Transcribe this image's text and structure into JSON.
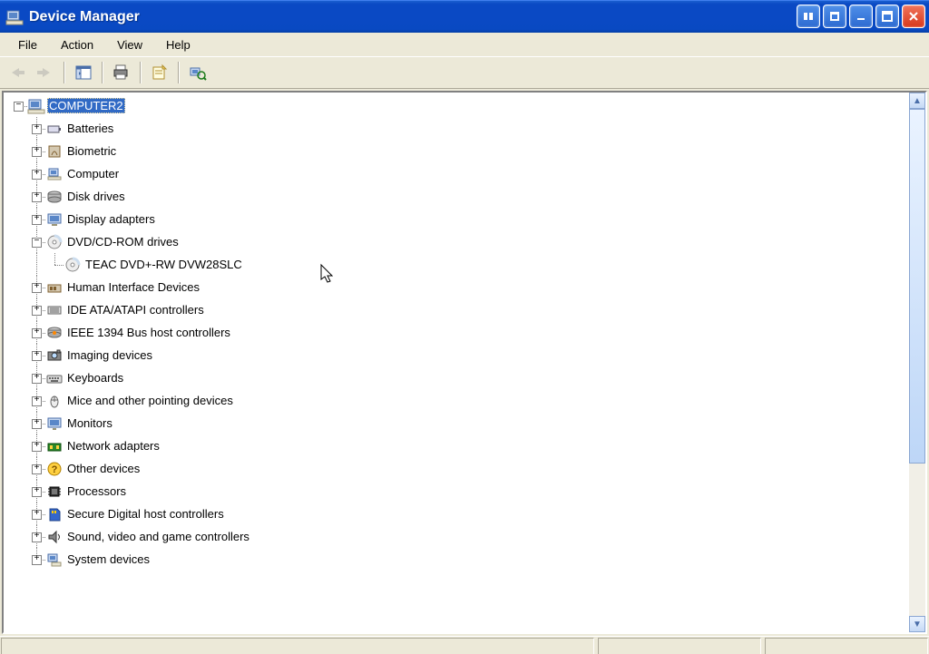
{
  "window": {
    "title": "Device Manager"
  },
  "menu": {
    "items": [
      "File",
      "Action",
      "View",
      "Help"
    ]
  },
  "toolbar": {
    "back": "back-arrow",
    "forward": "forward-arrow",
    "show_hide": "show-hide-console-tree",
    "print": "print",
    "properties": "properties",
    "scan": "scan-hardware"
  },
  "tree": {
    "root": {
      "label": "COMPUTER2",
      "icon": "computer",
      "expanded": true,
      "selected": true
    },
    "nodes": [
      {
        "label": "Batteries",
        "icon": "battery",
        "expanded": false
      },
      {
        "label": "Biometric",
        "icon": "biometric",
        "expanded": false
      },
      {
        "label": "Computer",
        "icon": "computer-small",
        "expanded": false
      },
      {
        "label": "Disk drives",
        "icon": "disk",
        "expanded": false
      },
      {
        "label": "Display adapters",
        "icon": "display",
        "expanded": false
      },
      {
        "label": "DVD/CD-ROM drives",
        "icon": "cd",
        "expanded": true,
        "children": [
          {
            "label": "TEAC DVD+-RW DVW28SLC",
            "icon": "cd"
          }
        ]
      },
      {
        "label": "Human Interface Devices",
        "icon": "hid",
        "expanded": false
      },
      {
        "label": "IDE ATA/ATAPI controllers",
        "icon": "ide",
        "expanded": false
      },
      {
        "label": "IEEE 1394 Bus host controllers",
        "icon": "1394",
        "expanded": false
      },
      {
        "label": "Imaging devices",
        "icon": "imaging",
        "expanded": false
      },
      {
        "label": "Keyboards",
        "icon": "keyboard",
        "expanded": false
      },
      {
        "label": "Mice and other pointing devices",
        "icon": "mouse",
        "expanded": false
      },
      {
        "label": "Monitors",
        "icon": "monitor",
        "expanded": false
      },
      {
        "label": "Network adapters",
        "icon": "network",
        "expanded": false
      },
      {
        "label": "Other devices",
        "icon": "unknown",
        "expanded": false
      },
      {
        "label": "Processors",
        "icon": "cpu",
        "expanded": false
      },
      {
        "label": "Secure Digital host controllers",
        "icon": "sd",
        "expanded": false
      },
      {
        "label": "Sound, video and game controllers",
        "icon": "sound",
        "expanded": false
      },
      {
        "label": "System devices",
        "icon": "system",
        "expanded": false
      }
    ]
  },
  "expander": {
    "plus": "+",
    "minus": "−"
  }
}
